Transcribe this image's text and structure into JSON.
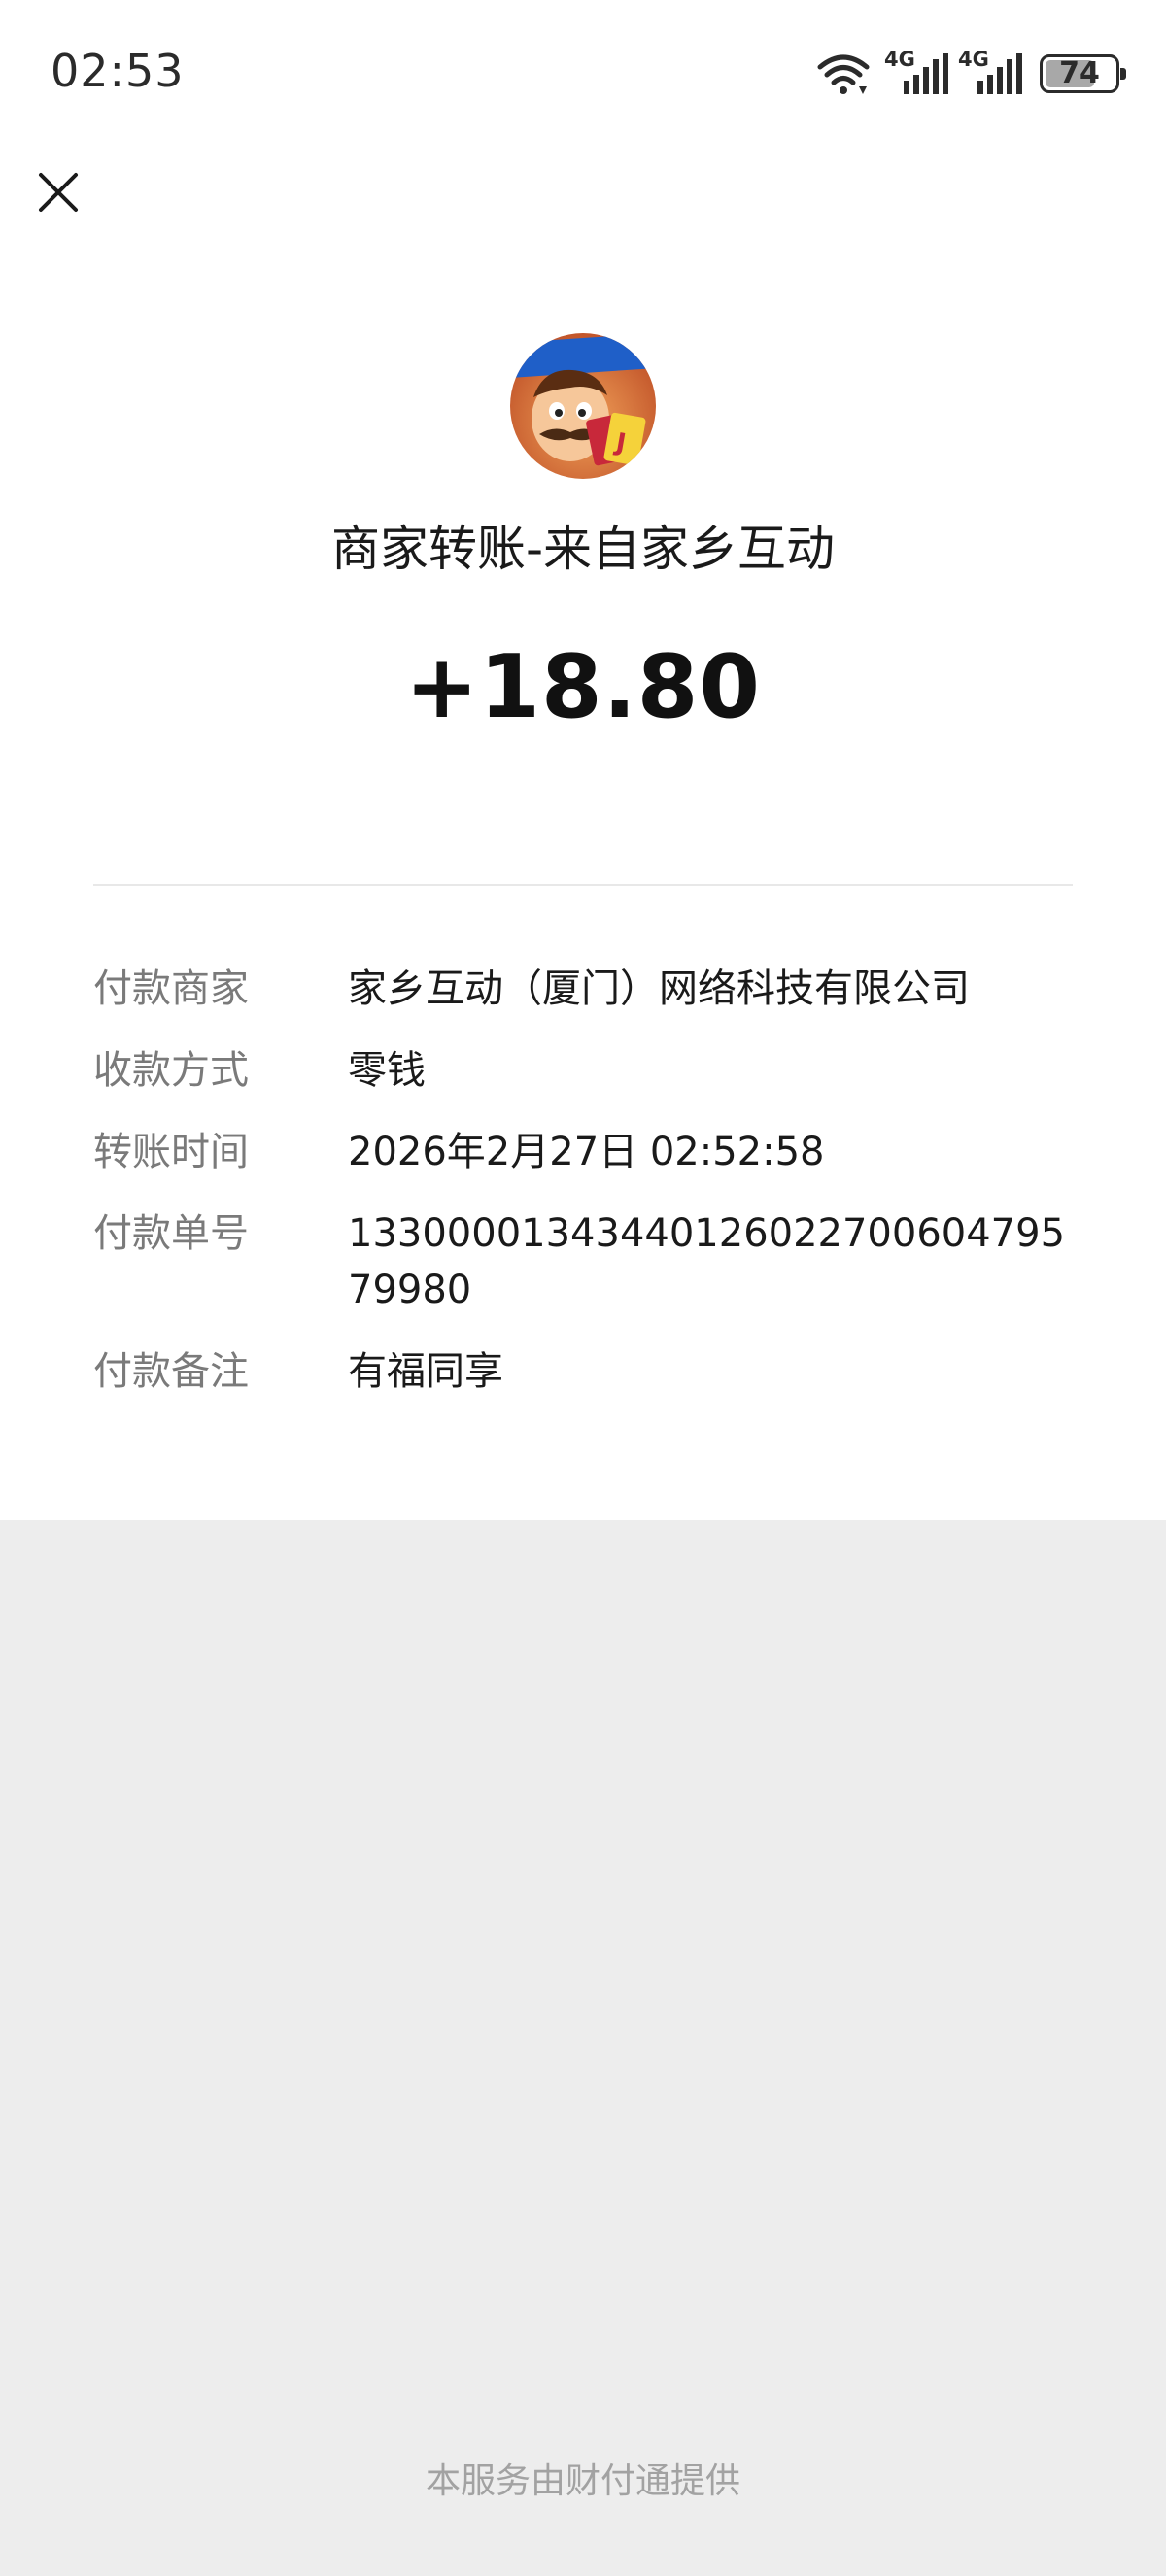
{
  "status_bar": {
    "time": "02:53",
    "network_1": "4G",
    "network_2": "4G",
    "battery_level": "74",
    "icons": [
      "wifi-icon",
      "signal-icon",
      "signal-icon",
      "battery-icon"
    ]
  },
  "header": {
    "close_icon": "close-icon"
  },
  "merchant": {
    "avatar_icon": "merchant-avatar",
    "title": "商家转账-来自家乡互动"
  },
  "amount": "+18.80",
  "details": [
    {
      "label": "付款商家",
      "value": "家乡互动（厦门）网络科技有限公司"
    },
    {
      "label": "收款方式",
      "value": "零钱"
    },
    {
      "label": "转账时间",
      "value": "2026年2月27日 02:52:58"
    },
    {
      "label": "付款单号",
      "value": "13300001343440126022700604795 79980"
    },
    {
      "label": "付款备注",
      "value": "有福同享"
    }
  ],
  "footer": {
    "text": "本服务由财付通提供"
  },
  "colors": {
    "page_background": "#ededed",
    "card_background": "#ffffff",
    "label_gray": "#7a7a7a",
    "footer_gray": "#a2a2a2"
  }
}
